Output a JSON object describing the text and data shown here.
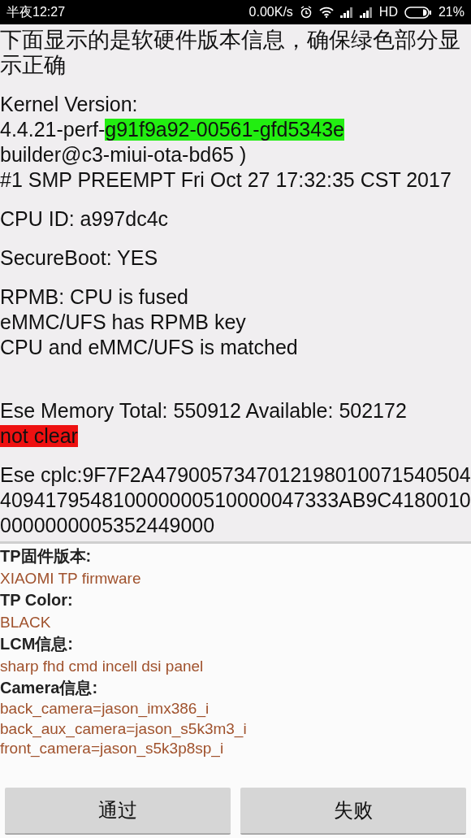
{
  "status_bar": {
    "time": "半夜12:27",
    "net_speed": "0.00K/s",
    "network": "HD",
    "battery": "21%"
  },
  "header": "下面显示的是软硬件版本信息，确保绿色部分显示正确",
  "info_blocks": [
    {
      "lines": [
        [
          {
            "text": "Kernel Version:"
          }
        ],
        [
          {
            "text": "4.4.21-perf-"
          },
          {
            "text": "g91f9a92-00561-gfd5343e",
            "color": "#22ee11"
          }
        ],
        [
          {
            "text": "builder@c3-miui-ota-bd65 )"
          }
        ],
        [
          {
            "text": "#1 SMP PREEMPT Fri Oct 27 17:32:35 CST 2017"
          }
        ]
      ]
    },
    {
      "lines": [
        [
          {
            "text": "CPU ID: a997dc4c"
          }
        ]
      ]
    },
    {
      "lines": [
        [
          {
            "text": "SecureBoot: YES"
          }
        ]
      ]
    },
    {
      "lines": [
        [
          {
            "text": "RPMB: CPU is fused"
          }
        ],
        [
          {
            "text": "eMMC/UFS has RPMB key"
          }
        ],
        [
          {
            "text": "CPU and eMMC/UFS is matched"
          }
        ]
      ]
    },
    {
      "lines": [
        [
          {
            "text": "Ese Memory Total: 550912 Available: 502172"
          }
        ],
        [
          {
            "text": "not clear",
            "color": "#ee1111"
          }
        ]
      ],
      "gap_before": true
    },
    {
      "lines": [
        [
          {
            "text": "Ese cplc:9F7F2A4790057347012198010071540504409417954810000000510000047333AB9C41800100000000005352449000"
          }
        ]
      ]
    }
  ],
  "hardware": [
    {
      "label": "TP固件版本:",
      "values": [
        "XIAOMI TP firmware"
      ]
    },
    {
      "label": "TP Color:",
      "values": [
        "BLACK"
      ]
    },
    {
      "label": "LCM信息:",
      "values": [
        "sharp fhd cmd incell dsi panel"
      ]
    },
    {
      "label": "Camera信息:",
      "values": [
        "back_camera=jason_imx386_i",
        "back_aux_camera=jason_s5k3m3_i",
        "front_camera=jason_s5k3p8sp_i"
      ]
    }
  ],
  "buttons": [
    "通过",
    "失败"
  ]
}
